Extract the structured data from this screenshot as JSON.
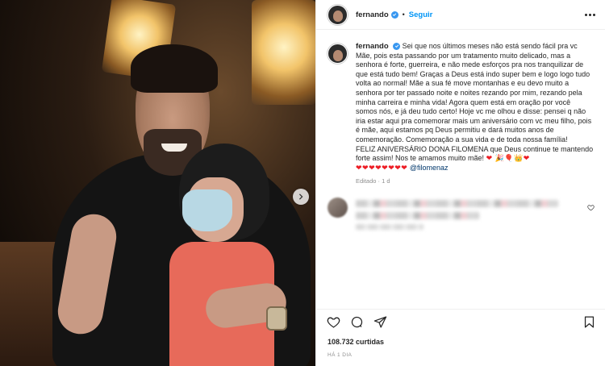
{
  "post": {
    "username": "fernando",
    "follow_label": "Seguir",
    "dot": "•",
    "caption_username": "fernando",
    "caption_text": "Sei que nos últimos meses não está sendo fácil pra vc Mãe, pois esta passando por um tratamento muito delicado, mas a senhora é forte, guerreira, e não mede esforços pra nos tranquilizar de que está tudo bem! Graças a Deus está indo super bem e logo logo tudo volta ao normal! Mãe a sua fé move montanhas e eu devo muito a senhora por ter passado noite e noites rezando por mim, rezando pela minha carreira e minha vida! Agora quem está em oração por você somos nós, e já deu tudo certo! Hoje vc me olhou e disse: pensei q não iria estar aqui pra comemorar mais um aniversário com vc meu filho, pois é mãe, aqui estamos pq Deus permitiu e dará muitos anos de comemoração. Comemoração a sua vida e de toda nossa família!",
    "caption_text_2": "FELIZ ANIVERSÁRIO DONA FILOMENA que Deus continue te mantendo forte assim! Nos te amamos muito mãe!",
    "caption_emojis": "❤ 🎉🎈👑❤",
    "caption_hearts": "❤❤❤❤❤❤❤❤",
    "mention": "@filomenaz",
    "edited_label": "Editado",
    "edited_dot": "·",
    "edited_age": "1 d",
    "likes_label": "108.732 curtidas",
    "time_ago": "HÁ 1 DIA"
  },
  "icons": {
    "verified": "verified-badge-icon",
    "more": "more-options-icon",
    "like": "heart-icon",
    "comment": "comment-icon",
    "share": "share-icon",
    "save": "bookmark-icon",
    "next": "chevron-right-icon"
  },
  "colors": {
    "accent": "#0095f6",
    "verified": "#3897f0",
    "heart": "#ed1c24",
    "mention": "#00376b",
    "muted": "#8e8e8e"
  }
}
